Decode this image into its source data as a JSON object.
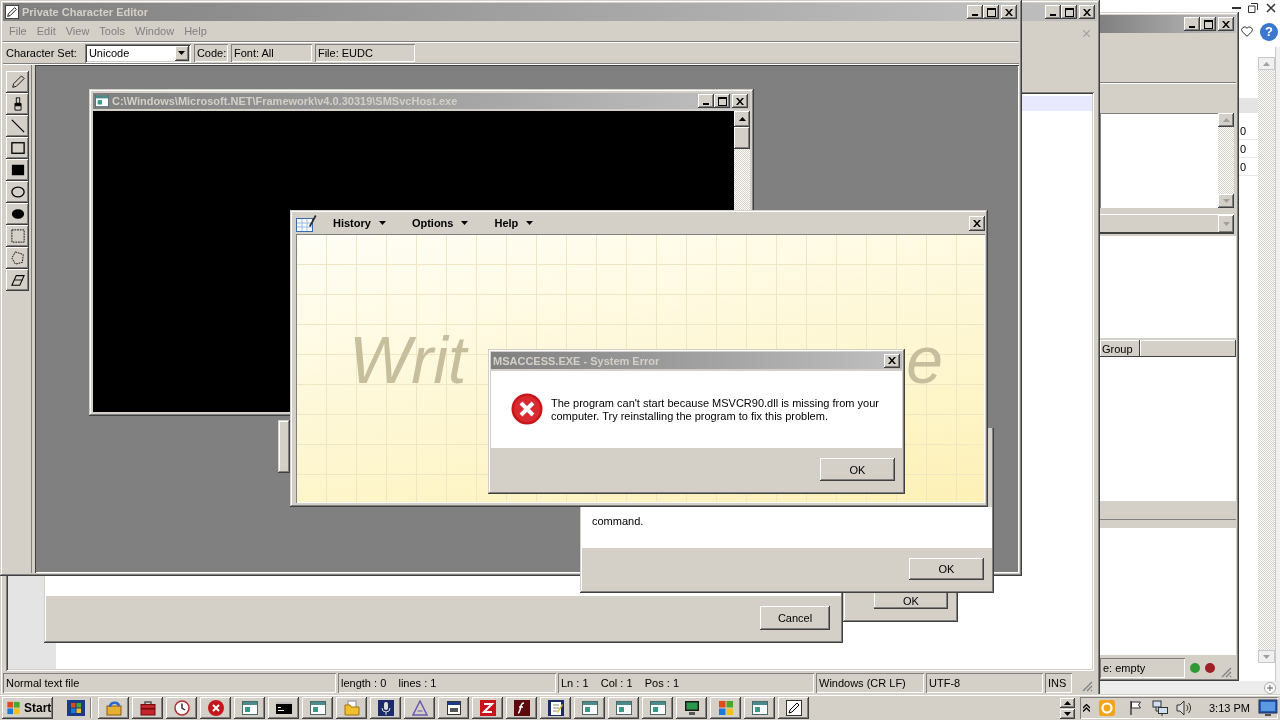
{
  "character_editor": {
    "title": "Private Character Editor",
    "menu": [
      {
        "label": "File",
        "disabled": true
      },
      {
        "label": "Edit",
        "disabled": true
      },
      {
        "label": "View",
        "disabled": true
      },
      {
        "label": "Tools",
        "disabled": true
      },
      {
        "label": "Window",
        "disabled": true
      },
      {
        "label": "Help",
        "disabled": true
      }
    ],
    "toolbar": {
      "character_set_label": "Character Set:",
      "character_set": "Unicode",
      "code": "Code:",
      "font": "Font: All",
      "file": "File: EUDC"
    }
  },
  "console_window": {
    "title": "C:\\Windows\\Microsoft.NET\\Framework\\v4.0.30319\\SMSvcHost.exe"
  },
  "input_panel": {
    "menu": [
      "History",
      "Options",
      "Help"
    ],
    "hint_left": "Writ",
    "hint_right": "e"
  },
  "error_dialog": {
    "title": "MSACCESS.EXE - System Error",
    "message": "The program can't start because MSVCR90.dll is missing from your computer. Try reinstalling the program to fix this problem.",
    "button": "OK"
  },
  "service_dialog": {
    "message_end": "command.",
    "button": "OK"
  },
  "cancel_dialog": {
    "button": "Cancel"
  },
  "ok_dialog": {
    "button": "OK"
  },
  "notepad_window": {
    "status_bar": {
      "file_type": "Normal text file",
      "length_lines": "length : 0    lines : 1",
      "position": "Ln : 1    Col : 1    Pos : 1",
      "line_ending": "Windows (CR LF)",
      "encoding": "UTF-8",
      "mode": "INS"
    }
  },
  "side_window": {
    "column_header": "Group",
    "status": "e: empty",
    "lights": [
      {
        "color": "#2e9a35"
      },
      {
        "color": "#a01e28"
      }
    ]
  },
  "browser_window": {
    "help_button": "?",
    "cells": [
      "0",
      "0",
      "0"
    ]
  },
  "taskbar": {
    "start": "Start",
    "clock": "3:13 PM"
  }
}
